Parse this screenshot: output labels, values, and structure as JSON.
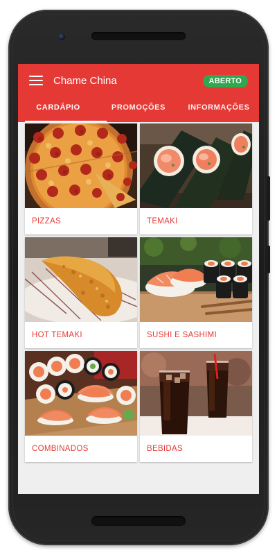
{
  "app": {
    "title": "Chame China",
    "status": "ABERTO"
  },
  "tabs": [
    {
      "label": "CARDÁPIO"
    },
    {
      "label": "PROMOÇÕES"
    },
    {
      "label": "INFORMAÇÕES"
    }
  ],
  "categories": [
    {
      "label": "PIZZAS",
      "image": "pizza-photo"
    },
    {
      "label": "TEMAKI",
      "image": "temaki-photo"
    },
    {
      "label": "HOT TEMAKI",
      "image": "hot-temaki-photo"
    },
    {
      "label": "SUSHI E SASHIMI",
      "image": "sushi-sashimi-photo"
    },
    {
      "label": "COMBINADOS",
      "image": "combinados-photo"
    },
    {
      "label": "BEBIDAS",
      "image": "bebidas-photo"
    }
  ],
  "colors": {
    "primary": "#e53935",
    "badge": "#2fa84f",
    "background": "#efefef",
    "card": "#ffffff"
  }
}
